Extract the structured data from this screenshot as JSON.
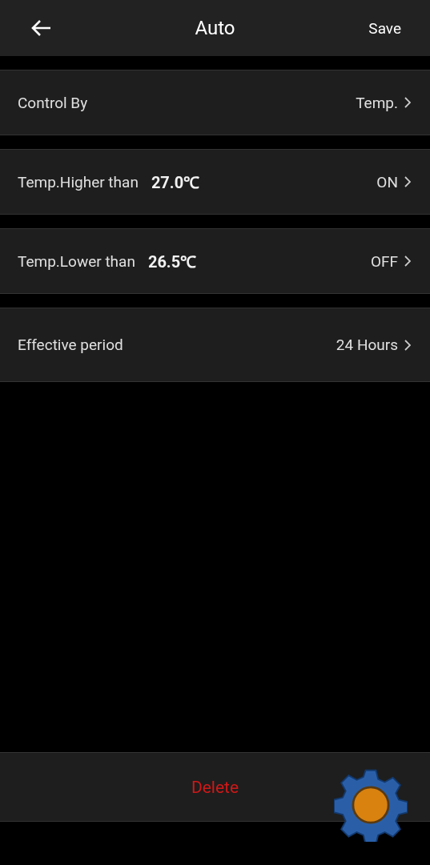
{
  "header": {
    "title": "Auto",
    "action": "Save"
  },
  "rows": [
    {
      "label": "Control By",
      "value": "Temp."
    },
    {
      "label": "Temp.Higher than",
      "reading": "27.0℃",
      "value": "ON"
    },
    {
      "label": "Temp.Lower than",
      "reading": "26.5℃",
      "value": "OFF"
    },
    {
      "label": "Effective period",
      "value": "24 Hours"
    }
  ],
  "footer": {
    "delete": "Delete"
  }
}
